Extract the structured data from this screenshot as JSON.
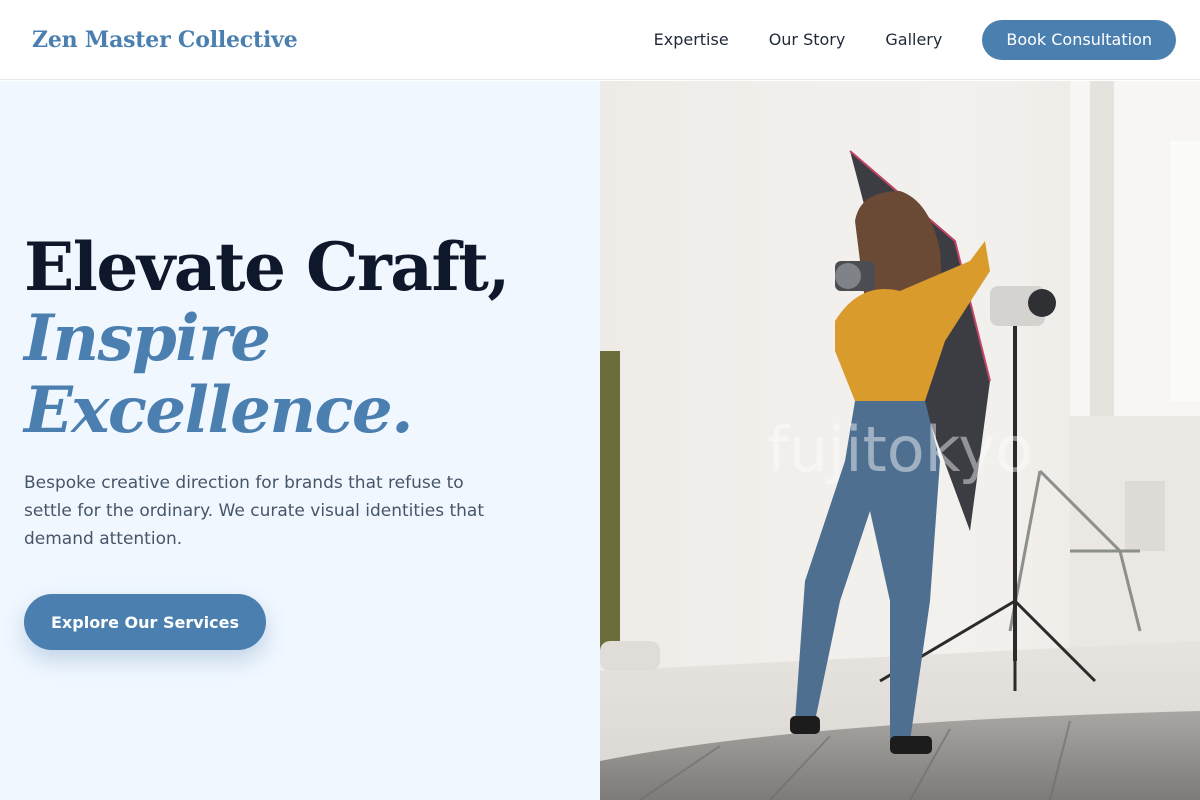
{
  "nav": {
    "brand": "Zen Master Collective",
    "links": [
      "Expertise",
      "Our Story",
      "Gallery"
    ],
    "cta": "Book Consultation"
  },
  "hero": {
    "headline_line1": "Elevate Craft,",
    "headline_line2": "Inspire",
    "headline_line3": "Excellence.",
    "subtext": "Bespoke creative direction for brands that refuse to settle for the ordinary. We curate visual identities that demand attention.",
    "cta": "Explore Our Services",
    "image_watermark": "fujitokyo"
  },
  "colors": {
    "accent": "#4a7fb0",
    "hero_bg": "#f0f7fe",
    "heading": "#0f172a",
    "body_text": "#475569"
  }
}
